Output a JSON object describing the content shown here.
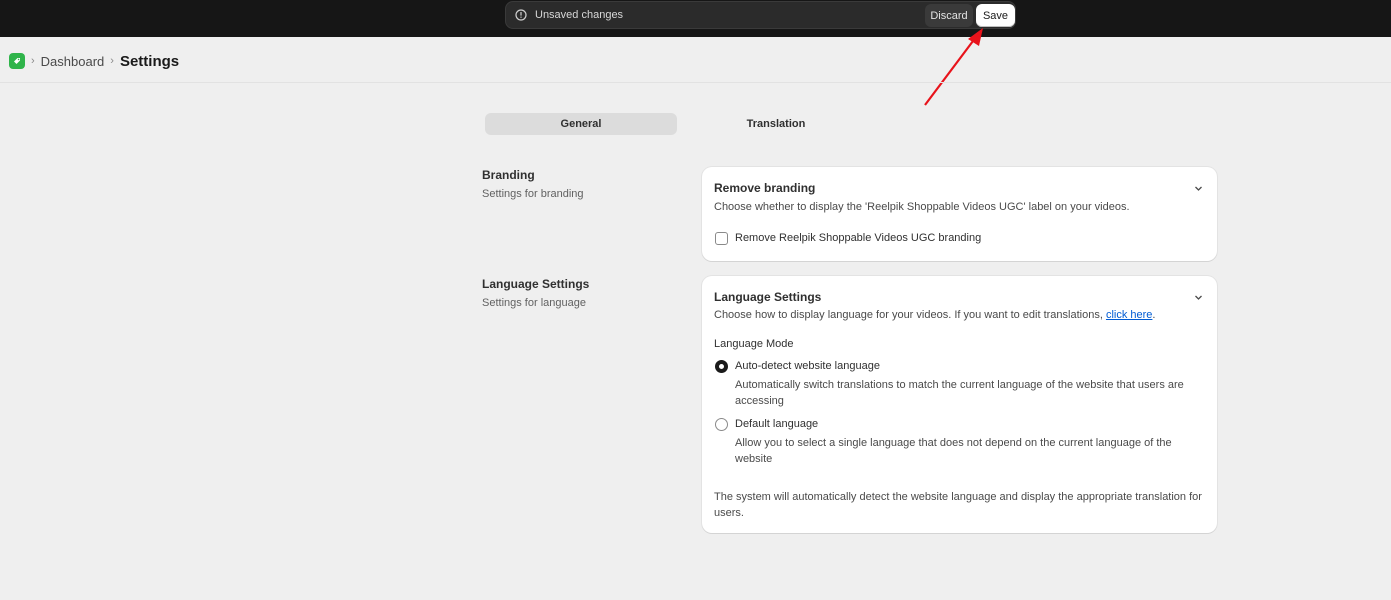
{
  "savebar": {
    "message": "Unsaved changes",
    "discard_label": "Discard",
    "save_label": "Save"
  },
  "breadcrumb": {
    "parent": "Dashboard",
    "current": "Settings"
  },
  "tabs": [
    {
      "label": "General",
      "active": true
    },
    {
      "label": "Translation",
      "active": false
    }
  ],
  "branding": {
    "section_title": "Branding",
    "section_subtitle": "Settings for branding",
    "card_title": "Remove branding",
    "card_description": "Choose whether to display the 'Reelpik Shoppable Videos UGC' label on your videos.",
    "checkbox_label": "Remove Reelpik Shoppable Videos UGC branding",
    "checkbox_checked": false
  },
  "language": {
    "section_title": "Language Settings",
    "section_subtitle": "Settings for language",
    "card_title": "Language Settings",
    "card_description_prefix": "Choose how to display language for your videos. If you want to edit translations, ",
    "card_description_link": "click here",
    "card_description_suffix": ".",
    "mode_label": "Language Mode",
    "options": [
      {
        "label": "Auto-detect website language",
        "help": "Automatically switch translations to match the current language of the website that users are accessing",
        "selected": true
      },
      {
        "label": "Default language",
        "help": "Allow you to select a single language that does not depend on the current language of the website",
        "selected": false
      }
    ],
    "footer_note": "The system will automatically detect the website language and display the appropriate translation for users."
  },
  "colors": {
    "topbar": "#161616",
    "accent_link": "#005bd3",
    "app_logo": "#2fb44a",
    "annotation_arrow": "#e8131b"
  }
}
